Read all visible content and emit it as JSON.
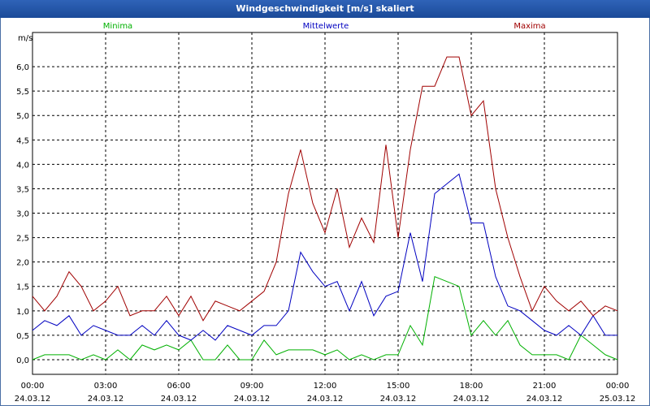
{
  "window": {
    "title": "Windgeschwindigkeit [m/s] skaliert"
  },
  "chart_data": {
    "type": "line",
    "title": "Windgeschwindigkeit [m/s] skaliert",
    "ylabel": "m/s",
    "xlabel": "",
    "ylim": [
      -0.3,
      6.7
    ],
    "xlim": [
      0,
      24
    ],
    "yticks": [
      0.0,
      0.5,
      1.0,
      1.5,
      2.0,
      2.5,
      3.0,
      3.5,
      4.0,
      4.5,
      5.0,
      5.5,
      6.0
    ],
    "ytick_labels": [
      "0,0",
      "0,5",
      "1,0",
      "1,5",
      "2,0",
      "2,5",
      "3,0",
      "3,5",
      "4,0",
      "4,5",
      "5,0",
      "5,5",
      "6,0"
    ],
    "xticks": [
      0,
      3,
      6,
      9,
      12,
      15,
      18,
      21,
      24
    ],
    "xtick_labels": [
      {
        "time": "00:00",
        "date": "24.03.12"
      },
      {
        "time": "03:00",
        "date": "24.03.12"
      },
      {
        "time": "06:00",
        "date": "24.03.12"
      },
      {
        "time": "09:00",
        "date": "24.03.12"
      },
      {
        "time": "12:00",
        "date": "24.03.12"
      },
      {
        "time": "15:00",
        "date": "24.03.12"
      },
      {
        "time": "18:00",
        "date": "24.03.12"
      },
      {
        "time": "21:00",
        "date": "24.03.12"
      },
      {
        "time": "00:00",
        "date": "25.03.12"
      }
    ],
    "grid": true,
    "legend_position": "top",
    "x": [
      0,
      0.5,
      1,
      1.5,
      2,
      2.5,
      3,
      3.5,
      4,
      4.5,
      5,
      5.5,
      6,
      6.5,
      7,
      7.5,
      8,
      8.5,
      9,
      9.5,
      10,
      10.5,
      11,
      11.5,
      12,
      12.5,
      13,
      13.5,
      14,
      14.5,
      15,
      15.5,
      16,
      16.5,
      17,
      17.5,
      18,
      18.5,
      19,
      19.5,
      20,
      20.5,
      21,
      21.5,
      22,
      22.5,
      23,
      23.5,
      24
    ],
    "series": [
      {
        "name": "Minima",
        "color": "#00b000",
        "values": [
          0,
          0.1,
          0.1,
          0.1,
          0,
          0.1,
          0,
          0.2,
          0,
          0.3,
          0.2,
          0.3,
          0.2,
          0.4,
          0,
          0,
          0.3,
          0,
          0,
          0.4,
          0.1,
          0.2,
          0.2,
          0.2,
          0.1,
          0.2,
          0,
          0.1,
          0,
          0.1,
          0.1,
          0.7,
          0.3,
          1.7,
          1.6,
          1.5,
          0.5,
          0.8,
          0.5,
          0.8,
          0.3,
          0.1,
          0.1,
          0.1,
          0,
          0.5,
          0.3,
          0.1,
          0
        ]
      },
      {
        "name": "Mittelwerte",
        "color": "#0000c0",
        "values": [
          0.6,
          0.8,
          0.7,
          0.9,
          0.5,
          0.7,
          0.6,
          0.5,
          0.5,
          0.7,
          0.5,
          0.8,
          0.5,
          0.4,
          0.6,
          0.4,
          0.7,
          0.6,
          0.5,
          0.7,
          0.7,
          1.0,
          2.2,
          1.8,
          1.5,
          1.6,
          1.0,
          1.6,
          0.9,
          1.3,
          1.4,
          2.6,
          1.6,
          3.4,
          3.6,
          3.8,
          2.8,
          2.8,
          1.7,
          1.1,
          1.0,
          0.8,
          0.6,
          0.5,
          0.7,
          0.5,
          0.9,
          0.5,
          0.5
        ]
      },
      {
        "name": "Maxima",
        "color": "#a00000",
        "values": [
          1.3,
          1.0,
          1.3,
          1.8,
          1.5,
          1.0,
          1.2,
          1.5,
          0.9,
          1.0,
          1.0,
          1.3,
          0.9,
          1.3,
          0.8,
          1.2,
          1.1,
          1.0,
          1.2,
          1.4,
          2.0,
          3.4,
          4.3,
          3.2,
          2.6,
          3.5,
          2.3,
          2.9,
          2.4,
          4.4,
          2.5,
          4.3,
          5.6,
          5.6,
          6.2,
          6.2,
          5.0,
          5.3,
          3.5,
          2.5,
          1.7,
          1.0,
          1.5,
          1.2,
          1.0,
          1.2,
          0.9,
          1.1,
          1.0
        ]
      }
    ]
  }
}
